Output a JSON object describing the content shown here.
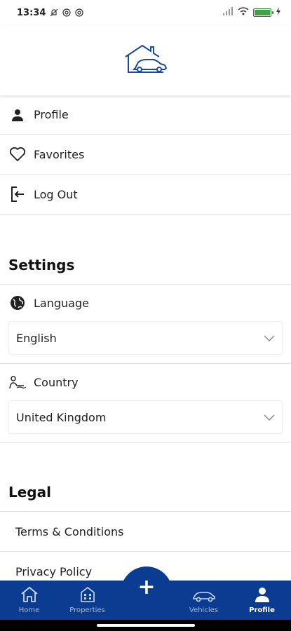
{
  "status_bar": {
    "time": "13:34"
  },
  "menu": {
    "profile": "Profile",
    "favorites": "Favorites",
    "logout": "Log Out"
  },
  "settings": {
    "title": "Settings",
    "language_label": "Language",
    "language_value": "English",
    "country_label": "Country",
    "country_value": "United Kingdom"
  },
  "legal": {
    "title": "Legal",
    "items": [
      "Terms & Conditions",
      "Privacy Policy"
    ]
  },
  "bottom_nav": {
    "items": [
      {
        "label": "Home",
        "icon": "home-icon"
      },
      {
        "label": "Properties",
        "icon": "building-icon"
      },
      {
        "label": "Vehicles",
        "icon": "car-icon"
      },
      {
        "label": "Profile",
        "icon": "person-icon"
      }
    ],
    "fab_label": "+",
    "active": "Profile"
  },
  "colors": {
    "primary": "#0a3d91",
    "divider": "#e3e3e3"
  }
}
